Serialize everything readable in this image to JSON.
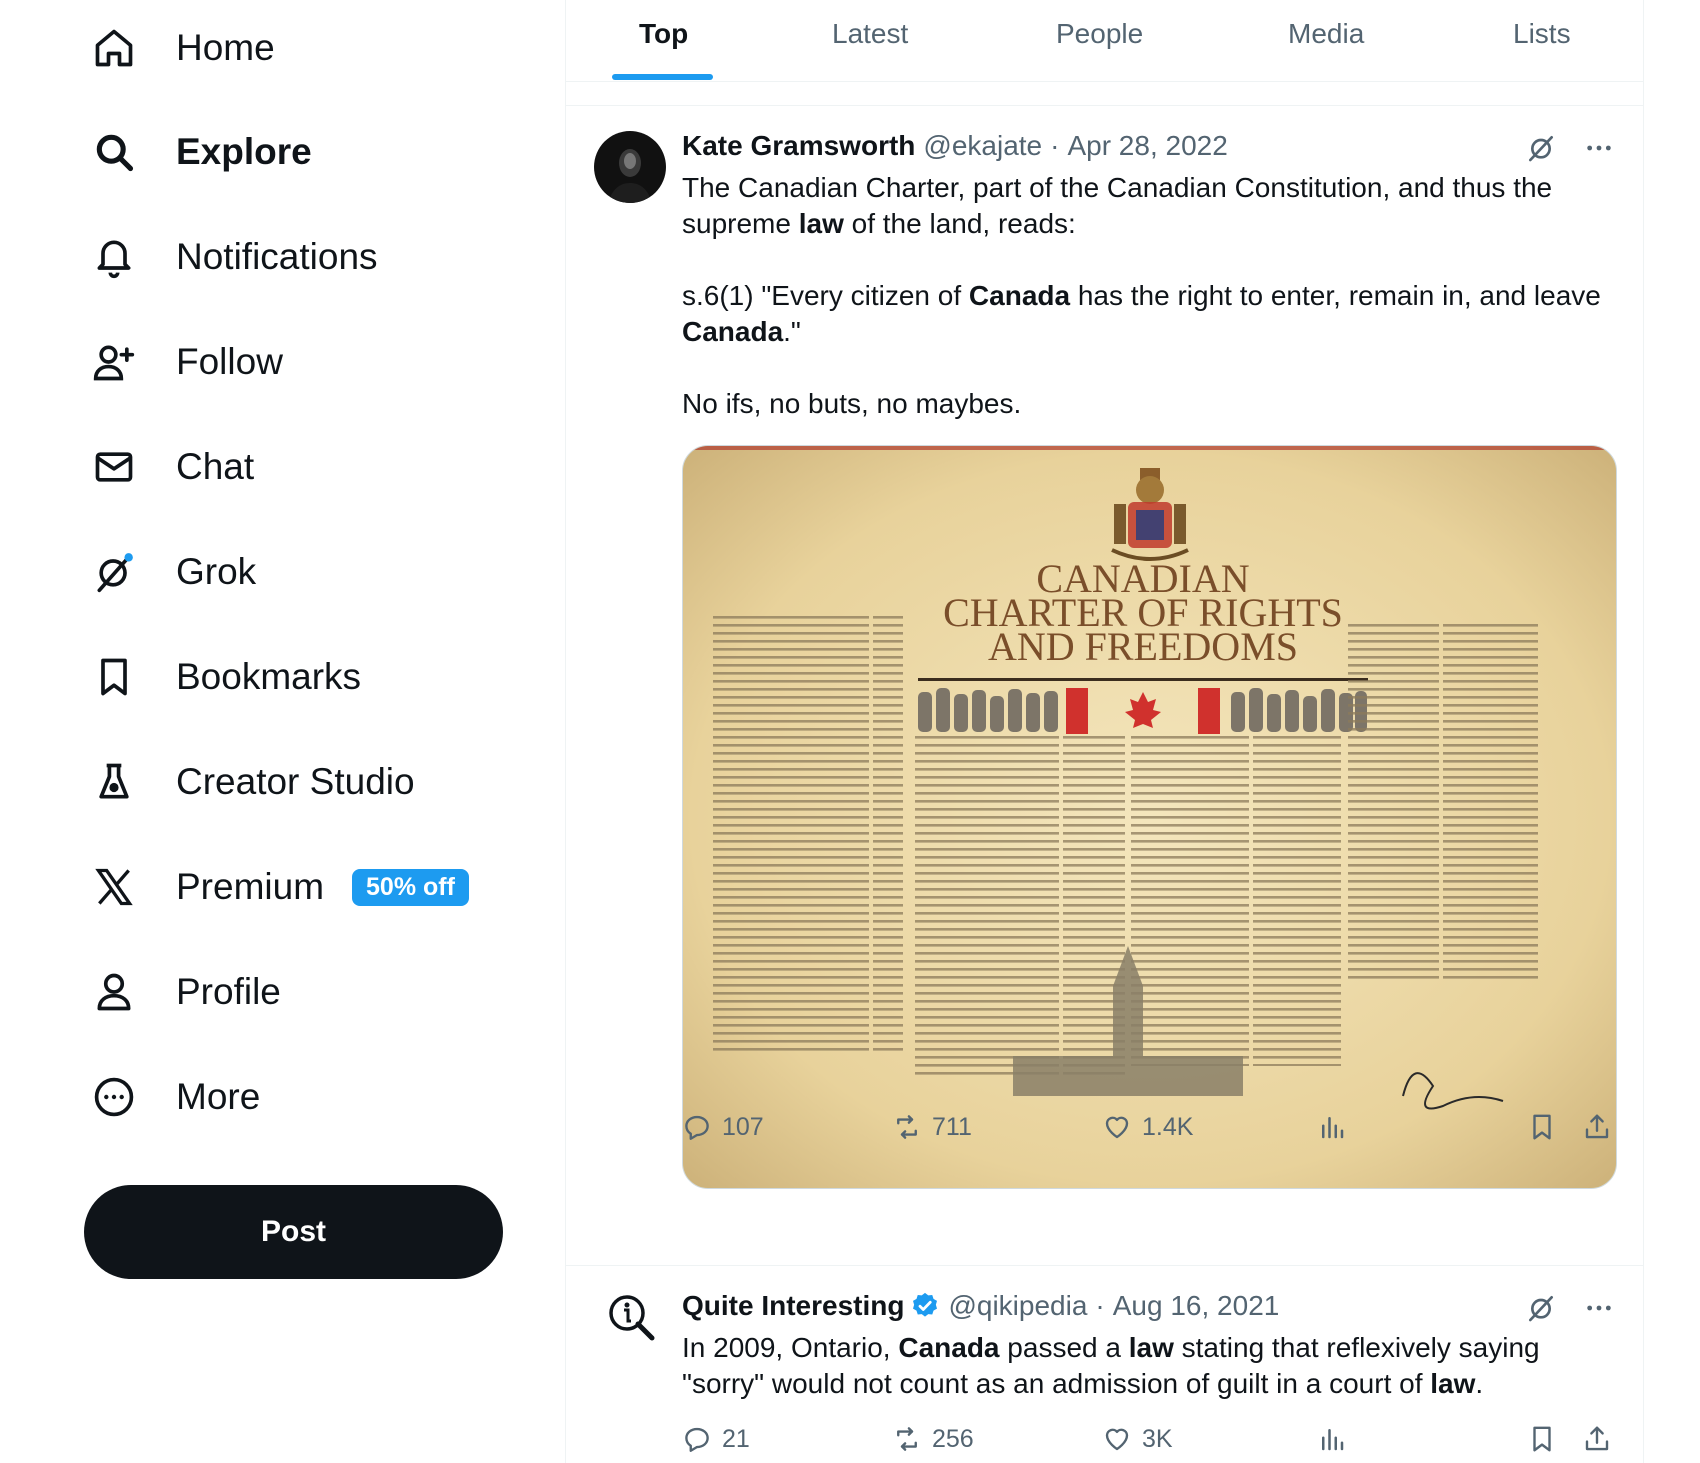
{
  "sidebar": {
    "items": [
      {
        "label": "Home",
        "icon": "home-icon"
      },
      {
        "label": "Explore",
        "icon": "search-icon"
      },
      {
        "label": "Notifications",
        "icon": "bell-icon"
      },
      {
        "label": "Follow",
        "icon": "follow-icon"
      },
      {
        "label": "Chat",
        "icon": "mail-icon"
      },
      {
        "label": "Grok",
        "icon": "grok-icon"
      },
      {
        "label": "Bookmarks",
        "icon": "bookmark-icon"
      },
      {
        "label": "Creator Studio",
        "icon": "flask-icon"
      },
      {
        "label": "Premium",
        "icon": "x-logo-icon",
        "badge": "50% off"
      },
      {
        "label": "Profile",
        "icon": "person-icon"
      },
      {
        "label": "More",
        "icon": "more-circle-icon"
      }
    ],
    "active": "Explore",
    "post_label": "Post"
  },
  "tabs": [
    "Top",
    "Latest",
    "People",
    "Media",
    "Lists"
  ],
  "active_tab": "Top",
  "tweets": [
    {
      "name": "Kate Gramsworth",
      "handle": "@ekajate",
      "date": "Apr 28, 2022",
      "text": {
        "p1_a": "The Canadian Charter, part of the Canadian Constitution, and thus the supreme ",
        "p1_law": "law",
        "p1_b": " of the land, reads:",
        "p2_a": "s.6(1) \"Every citizen of ",
        "p2_canada1": "Canada",
        "p2_b": " has the right to enter, remain in, and leave ",
        "p2_canada2": "Canada",
        "p2_c": ".\"",
        "p3": "No ifs, no buts, no maybes."
      },
      "media": {
        "title_line1": "CANADIAN",
        "title_line2": "CHARTER OF RIGHTS",
        "title_line3": "AND FREEDOMS"
      },
      "stats": {
        "replies": "107",
        "reposts": "711",
        "likes": "1.4K"
      }
    },
    {
      "name": "Quite Interesting",
      "handle": "@qikipedia",
      "date": "Aug 16, 2021",
      "verified": true,
      "text": {
        "a": "In 2009, Ontario, ",
        "canada": "Canada",
        "b": " passed a ",
        "law1": "law",
        "c": " stating that reflexively saying \"sorry\" would not count as an admission of guilt in a court of ",
        "law2": "law",
        "d": "."
      },
      "stats": {
        "replies": "21",
        "reposts": "256",
        "likes": "3K"
      }
    }
  ],
  "colors": {
    "accent": "#1d9bf0",
    "text": "#0f1419",
    "muted": "#536471",
    "border": "#eff3f4"
  }
}
